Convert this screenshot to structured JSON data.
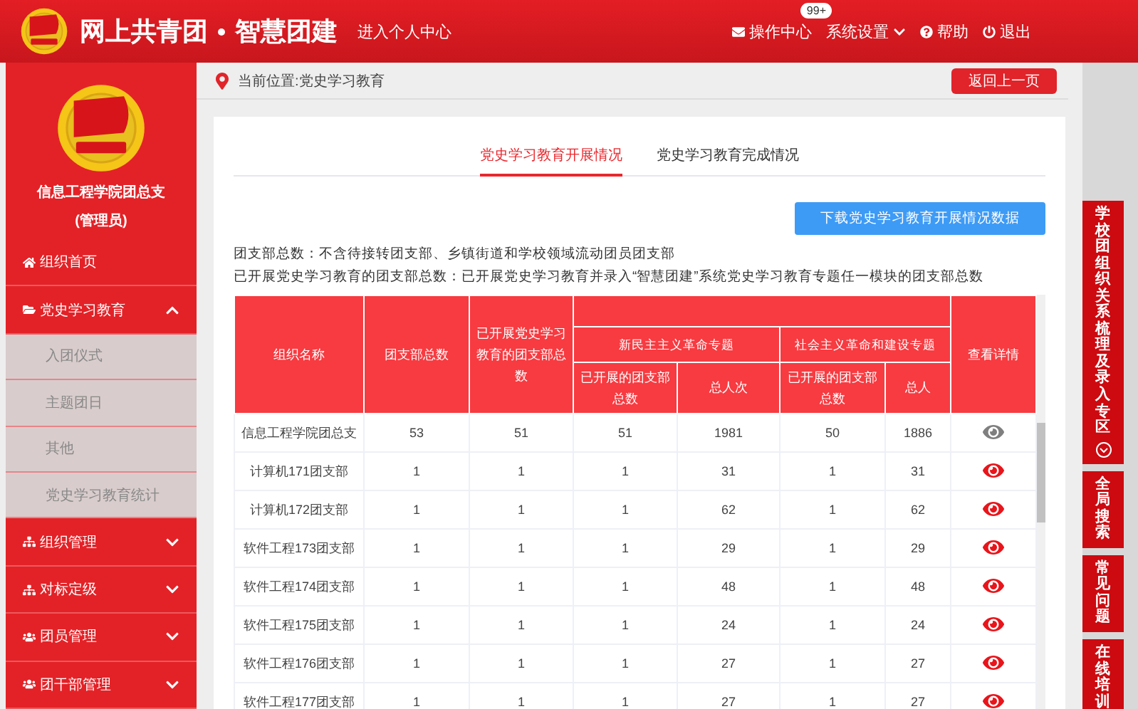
{
  "header": {
    "title": "网上共青团",
    "subtitle": "智慧团建",
    "personal_link": "进入个人中心",
    "actions": [
      {
        "kind": "mail",
        "label": "操作中心",
        "badge": "99+"
      },
      {
        "kind": "settings",
        "label": "系统设置"
      },
      {
        "kind": "help",
        "label": "帮助"
      },
      {
        "kind": "logout",
        "label": "退出"
      }
    ]
  },
  "sidebar": {
    "org_name": "信息工程学院团总支",
    "role": "(管理员)",
    "items": [
      {
        "kind": "home",
        "label": "组织首页"
      },
      {
        "kind": "folder",
        "label": "党史学习教育",
        "expanded": true,
        "children": [
          {
            "label": "入团仪式"
          },
          {
            "label": "主题团日"
          },
          {
            "label": "其他"
          },
          {
            "label": "党史学习教育统计"
          }
        ]
      },
      {
        "kind": "tree",
        "label": "组织管理",
        "expanded": false
      },
      {
        "kind": "tree",
        "label": "对标定级",
        "expanded": false
      },
      {
        "kind": "users",
        "label": "团员管理",
        "expanded": false
      },
      {
        "kind": "users",
        "label": "团干部管理",
        "expanded": false
      }
    ]
  },
  "breadcrumb": {
    "text": "当前位置:党史学习教育",
    "back_button": "返回上一页"
  },
  "tabs": [
    {
      "label": "党史学习教育开展情况",
      "selected": true
    },
    {
      "label": "党史学习教育完成情况",
      "selected": false
    }
  ],
  "download_button": "下载党史学习教育开展情况数据",
  "notes": [
    "团支部总数：不含待接转团支部、乡镇街道和学校领域流动团员团支部",
    "已开展党史学习教育的团支部总数：已开展党史学习教育并录入“智慧团建”系统党史学习教育专题任一模块的团支部总数"
  ],
  "table": {
    "columns": [
      "组织名称",
      "团支部总数",
      "已开展党史学习教育的团支部总数",
      "查看详情"
    ],
    "groups": [
      "新民主主义革命专题",
      "社会主义革命和建设专题"
    ],
    "sub_columns": [
      "已开展的团支部总数",
      "总人次",
      "已开展的团支部总数",
      "总人"
    ],
    "rows": [
      {
        "cells": [
          "信息工程学院团总支",
          "53",
          "51",
          "51",
          "1981",
          "50",
          "1886"
        ],
        "color": "#7f7f7f"
      },
      {
        "cells": [
          "计算机171团支部",
          "1",
          "1",
          "1",
          "31",
          "1",
          "31"
        ],
        "color": "#e8151b"
      },
      {
        "cells": [
          "计算机172团支部",
          "1",
          "1",
          "1",
          "62",
          "1",
          "62"
        ],
        "color": "#e8151b"
      },
      {
        "cells": [
          "软件工程173团支部",
          "1",
          "1",
          "1",
          "29",
          "1",
          "29"
        ],
        "color": "#e8151b"
      },
      {
        "cells": [
          "软件工程174团支部",
          "1",
          "1",
          "1",
          "48",
          "1",
          "48"
        ],
        "color": "#e8151b"
      },
      {
        "cells": [
          "软件工程175团支部",
          "1",
          "1",
          "1",
          "24",
          "1",
          "24"
        ],
        "color": "#e8151b"
      },
      {
        "cells": [
          "软件工程176团支部",
          "1",
          "1",
          "1",
          "27",
          "1",
          "27"
        ],
        "color": "#e8151b"
      },
      {
        "cells": [
          "软件工程177团支部",
          "1",
          "1",
          "1",
          "27",
          "1",
          "27"
        ],
        "color": "#e8151b"
      }
    ]
  },
  "right_rail": [
    {
      "label": "学校团组织关系梳理及录入专区",
      "kind": "expand"
    },
    {
      "label": "全局搜索",
      "kind": "plain"
    },
    {
      "label": "常见问题",
      "kind": "plain"
    },
    {
      "label": "在线培训",
      "kind": "plain"
    }
  ]
}
